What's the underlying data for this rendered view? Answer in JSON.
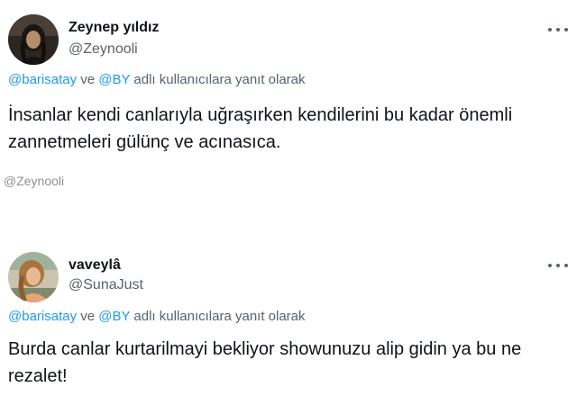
{
  "tweets": [
    {
      "display_name": "Zeynep yıldız",
      "handle": "@Zeynooli",
      "avatar": "avatar-portrait-dark",
      "more_icon": "more-horizontal-icon",
      "reply": {
        "mention_1": "@barisatay",
        "connector": " ve ",
        "mention_2": "@BY",
        "suffix": " adlı kullanıcılara yanıt olarak"
      },
      "text": "İnsanlar kendi canlarıyla uğraşırken kendilerini bu kadar önemli zannetmeleri gülünç ve acınasıca."
    },
    {
      "display_name": "vaveylâ",
      "handle": "@SunaJust",
      "avatar": "avatar-portrait-outdoor",
      "more_icon": "more-horizontal-icon",
      "reply": {
        "mention_1": "@barisatay",
        "connector": " ve ",
        "mention_2": "@BY",
        "suffix": " adlı kullanıcılara yanıt olarak"
      },
      "text": "Burda canlar kurtarilmayi bekliyor showunuzu alip gidin ya bu ne rezalet!"
    }
  ],
  "watermark": "@Zeynooli"
}
